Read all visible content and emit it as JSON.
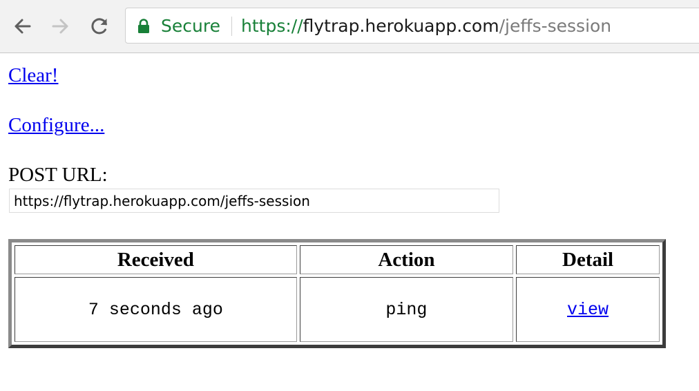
{
  "browser": {
    "back_icon": "arrow-left-icon",
    "forward_icon": "arrow-right-icon",
    "reload_icon": "reload-icon",
    "lock_icon": "lock-icon",
    "secure_label": "Secure",
    "url_scheme": "https://",
    "url_host": "flytrap.herokuapp.com",
    "url_path": "/jeffs-session",
    "colors": {
      "secure": "#188038",
      "path": "#7a7a7a"
    }
  },
  "page": {
    "clear_link": "Clear!",
    "configure_link": "Configure...",
    "post_url_label": "POST URL:",
    "post_url_value": "https://flytrap.herokuapp.com/jeffs-session",
    "link_color": "#0000ee"
  },
  "table": {
    "headers": {
      "received": "Received",
      "action": "Action",
      "detail": "Detail"
    },
    "rows": [
      {
        "received": "7 seconds ago",
        "action": "ping",
        "detail": "view"
      }
    ]
  }
}
